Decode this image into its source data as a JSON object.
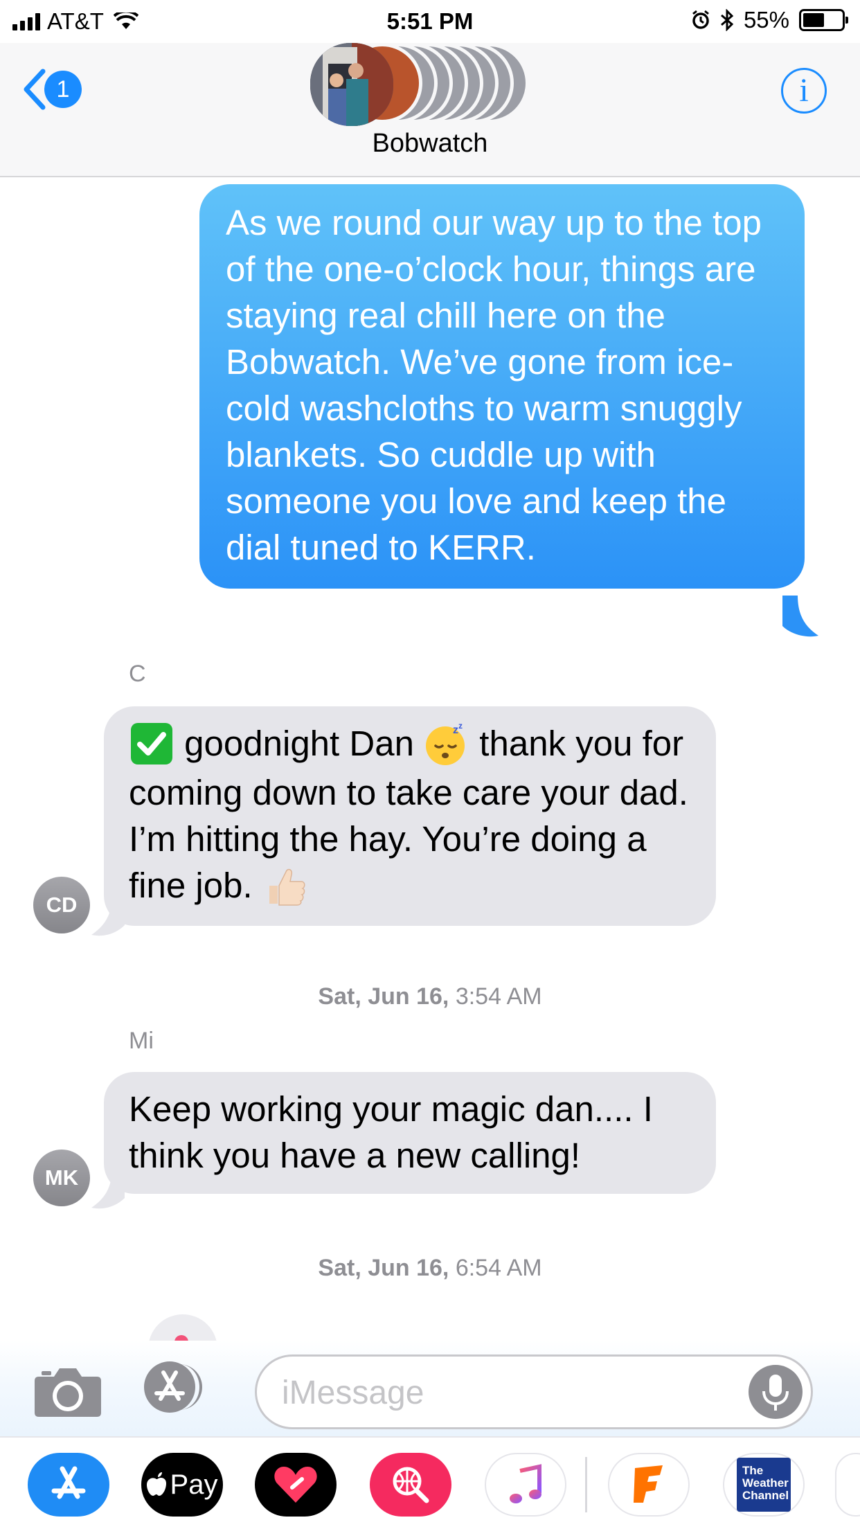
{
  "status_bar": {
    "carrier": "AT&T",
    "time": "5:51 PM",
    "battery_percent": "55%",
    "battery_level": 0.55
  },
  "header": {
    "back_badge": "1",
    "info_glyph": "i",
    "title": "Bobwatch"
  },
  "messages": [
    {
      "direction": "outgoing",
      "text": "As we round our way up to the top of the one-o’clock hour, things are staying real chill here on the Bobwatch. We’ve gone from ice-cold washcloths to warm snuggly blankets. So cuddle up with someone you love and keep the dial tuned to KERR."
    },
    {
      "direction": "incoming",
      "sender": "C",
      "avatar": "CD",
      "lead": "goodnight Dan",
      "middle": "thank you for coming down to take care your dad. I’m hitting the hay. You’re doing a fine job.",
      "emoji": [
        "check-mark-emoji",
        "sleeping-face-emoji",
        "thumbs-up-emoji"
      ]
    },
    {
      "direction": "incoming",
      "sender": "Mi",
      "avatar": "MK",
      "text": "Keep working your magic dan.... I think you have a new calling!"
    }
  ],
  "timestamps": [
    {
      "day": "Sat, Jun 16,",
      "time": "3:54 AM"
    },
    {
      "day": "Sat, Jun 16,",
      "time": "6:54 AM"
    }
  ],
  "composer": {
    "placeholder": "iMessage"
  },
  "app_drawer": {
    "apps": [
      "App Store",
      "Apple Pay",
      "Digital Touch",
      "Images Search",
      "Music",
      "Fandango",
      "The Weather Channel"
    ],
    "apple_pay_label": "Pay",
    "weather_label_1": "The",
    "weather_label_2": "Weather",
    "weather_label_3": "Channel"
  },
  "colors": {
    "accent": "#1a8cff",
    "outgoing_top": "#60c2f9",
    "outgoing_bottom": "#2b92f7",
    "incoming_bubble": "#e5e5ea",
    "secondary_text": "#8e8e93"
  }
}
